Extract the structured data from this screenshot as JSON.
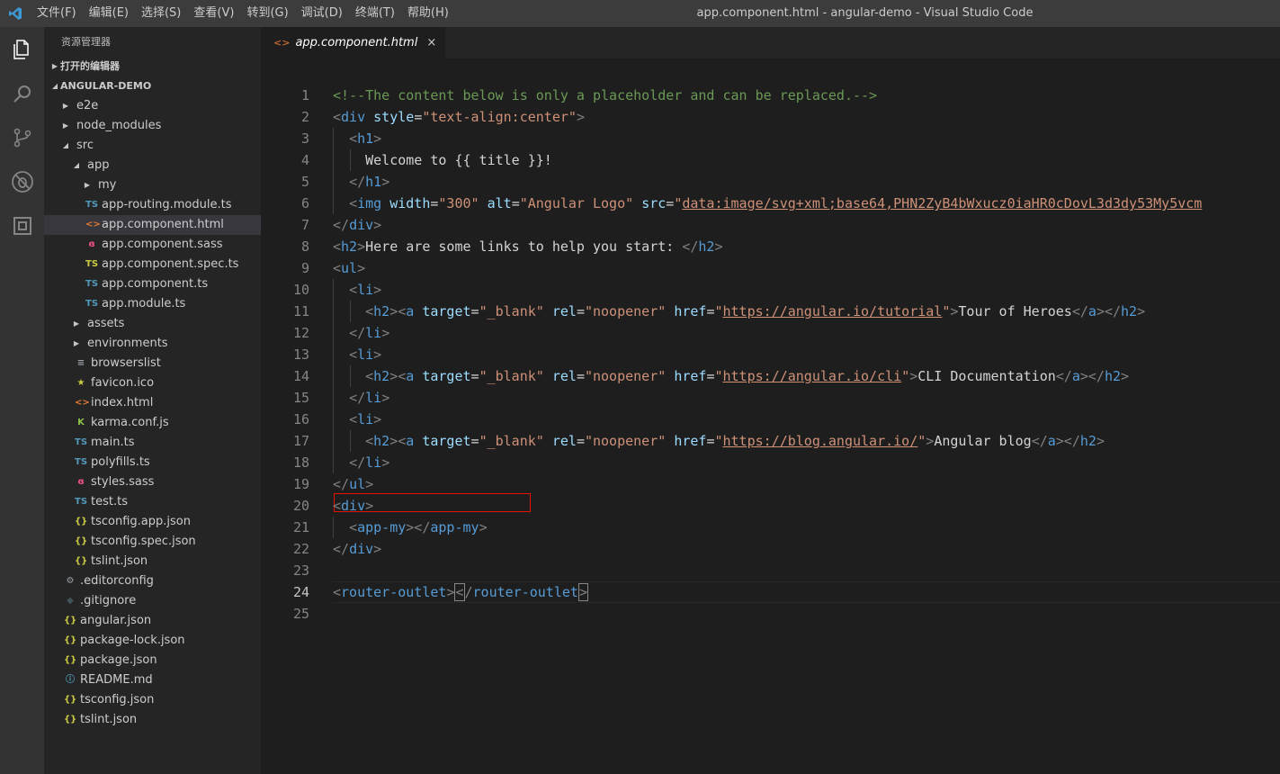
{
  "window": {
    "title": "app.component.html - angular-demo - Visual Studio Code",
    "menu": [
      "文件(F)",
      "编辑(E)",
      "选择(S)",
      "查看(V)",
      "转到(G)",
      "调试(D)",
      "终端(T)",
      "帮助(H)"
    ]
  },
  "activity_bar": [
    "files-icon",
    "search-icon",
    "source-control-icon",
    "debug-icon",
    "extensions-icon"
  ],
  "sidebar": {
    "title": "资源管理器",
    "open_editors": "打开的编辑器",
    "project": "ANGULAR-DEMO",
    "tree": [
      {
        "label": "e2e",
        "type": "folder",
        "expanded": false,
        "depth": 1
      },
      {
        "label": "node_modules",
        "type": "folder",
        "expanded": false,
        "depth": 1
      },
      {
        "label": "src",
        "type": "folder",
        "expanded": true,
        "depth": 1
      },
      {
        "label": "app",
        "type": "folder",
        "expanded": true,
        "depth": 2
      },
      {
        "label": "my",
        "type": "folder",
        "expanded": false,
        "depth": 3
      },
      {
        "label": "app-routing.module.ts",
        "type": "ts",
        "depth": 3
      },
      {
        "label": "app.component.html",
        "type": "html",
        "depth": 3,
        "selected": true
      },
      {
        "label": "app.component.sass",
        "type": "sass",
        "depth": 3
      },
      {
        "label": "app.component.spec.ts",
        "type": "spec",
        "depth": 3
      },
      {
        "label": "app.component.ts",
        "type": "ts",
        "depth": 3
      },
      {
        "label": "app.module.ts",
        "type": "ts",
        "depth": 3
      },
      {
        "label": "assets",
        "type": "folder",
        "expanded": false,
        "depth": 2
      },
      {
        "label": "environments",
        "type": "folder",
        "expanded": false,
        "depth": 2
      },
      {
        "label": "browserslist",
        "type": "list",
        "depth": 2
      },
      {
        "label": "favicon.ico",
        "type": "star",
        "depth": 2
      },
      {
        "label": "index.html",
        "type": "html",
        "depth": 2
      },
      {
        "label": "karma.conf.js",
        "type": "karma",
        "depth": 2
      },
      {
        "label": "main.ts",
        "type": "ts",
        "depth": 2
      },
      {
        "label": "polyfills.ts",
        "type": "ts",
        "depth": 2
      },
      {
        "label": "styles.sass",
        "type": "sass",
        "depth": 2
      },
      {
        "label": "test.ts",
        "type": "ts",
        "depth": 2
      },
      {
        "label": "tsconfig.app.json",
        "type": "json",
        "depth": 2
      },
      {
        "label": "tsconfig.spec.json",
        "type": "json",
        "depth": 2
      },
      {
        "label": "tslint.json",
        "type": "json",
        "depth": 2
      },
      {
        "label": ".editorconfig",
        "type": "gear",
        "depth": 1
      },
      {
        "label": ".gitignore",
        "type": "git",
        "depth": 1
      },
      {
        "label": "angular.json",
        "type": "json",
        "depth": 1
      },
      {
        "label": "package-lock.json",
        "type": "json",
        "depth": 1
      },
      {
        "label": "package.json",
        "type": "json",
        "depth": 1
      },
      {
        "label": "README.md",
        "type": "info",
        "depth": 1
      },
      {
        "label": "tsconfig.json",
        "type": "json",
        "depth": 1
      },
      {
        "label": "tslint.json",
        "type": "json",
        "depth": 1
      }
    ]
  },
  "editor": {
    "tab": {
      "label": "app.component.html",
      "icon": "html-icon",
      "close": "×"
    },
    "active_line": 24,
    "lines": [
      [
        [
          "c-com",
          "<!--The content below is only a placeholder and can be replaced.-->"
        ]
      ],
      [
        [
          "c-br",
          "<"
        ],
        [
          "c-tag",
          "div"
        ],
        [
          "c-txt",
          " "
        ],
        [
          "c-attr",
          "style"
        ],
        [
          "c-txt",
          "="
        ],
        [
          "c-str",
          "\"text-align:center\""
        ],
        [
          "c-br",
          ">"
        ]
      ],
      [
        [
          "c-txt",
          "  "
        ],
        [
          "c-br",
          "<"
        ],
        [
          "c-tag",
          "h1"
        ],
        [
          "c-br",
          ">"
        ]
      ],
      [
        [
          "c-txt",
          "    Welcome to {{ title }}!"
        ]
      ],
      [
        [
          "c-txt",
          "  "
        ],
        [
          "c-br",
          "</"
        ],
        [
          "c-tag",
          "h1"
        ],
        [
          "c-br",
          ">"
        ]
      ],
      [
        [
          "c-txt",
          "  "
        ],
        [
          "c-br",
          "<"
        ],
        [
          "c-tag",
          "img"
        ],
        [
          "c-txt",
          " "
        ],
        [
          "c-attr",
          "width"
        ],
        [
          "c-txt",
          "="
        ],
        [
          "c-str",
          "\"300\""
        ],
        [
          "c-txt",
          " "
        ],
        [
          "c-attr",
          "alt"
        ],
        [
          "c-txt",
          "="
        ],
        [
          "c-str",
          "\"Angular Logo\""
        ],
        [
          "c-txt",
          " "
        ],
        [
          "c-attr",
          "src"
        ],
        [
          "c-txt",
          "="
        ],
        [
          "c-str",
          "\""
        ],
        [
          "c-url",
          "data:image/svg+xml;base64,PHN2ZyB4bWxucz0iaHR0cDovL3d3dy53My5vcm"
        ]
      ],
      [
        [
          "c-br",
          "</"
        ],
        [
          "c-tag",
          "div"
        ],
        [
          "c-br",
          ">"
        ]
      ],
      [
        [
          "c-br",
          "<"
        ],
        [
          "c-tag",
          "h2"
        ],
        [
          "c-br",
          ">"
        ],
        [
          "c-txt",
          "Here are some links to help you start: "
        ],
        [
          "c-br",
          "</"
        ],
        [
          "c-tag",
          "h2"
        ],
        [
          "c-br",
          ">"
        ]
      ],
      [
        [
          "c-br",
          "<"
        ],
        [
          "c-tag",
          "ul"
        ],
        [
          "c-br",
          ">"
        ]
      ],
      [
        [
          "c-txt",
          "  "
        ],
        [
          "c-br",
          "<"
        ],
        [
          "c-tag",
          "li"
        ],
        [
          "c-br",
          ">"
        ]
      ],
      [
        [
          "c-txt",
          "    "
        ],
        [
          "c-br",
          "<"
        ],
        [
          "c-tag",
          "h2"
        ],
        [
          "c-br",
          "><"
        ],
        [
          "c-tag",
          "a"
        ],
        [
          "c-txt",
          " "
        ],
        [
          "c-attr",
          "target"
        ],
        [
          "c-txt",
          "="
        ],
        [
          "c-str",
          "\"_blank\""
        ],
        [
          "c-txt",
          " "
        ],
        [
          "c-attr",
          "rel"
        ],
        [
          "c-txt",
          "="
        ],
        [
          "c-str",
          "\"noopener\""
        ],
        [
          "c-txt",
          " "
        ],
        [
          "c-attr",
          "href"
        ],
        [
          "c-txt",
          "="
        ],
        [
          "c-str",
          "\""
        ],
        [
          "c-url",
          "https://angular.io/tutorial"
        ],
        [
          "c-str",
          "\""
        ],
        [
          "c-br",
          ">"
        ],
        [
          "c-txt",
          "Tour of Heroes"
        ],
        [
          "c-br",
          "</"
        ],
        [
          "c-tag",
          "a"
        ],
        [
          "c-br",
          "></"
        ],
        [
          "c-tag",
          "h2"
        ],
        [
          "c-br",
          ">"
        ]
      ],
      [
        [
          "c-txt",
          "  "
        ],
        [
          "c-br",
          "</"
        ],
        [
          "c-tag",
          "li"
        ],
        [
          "c-br",
          ">"
        ]
      ],
      [
        [
          "c-txt",
          "  "
        ],
        [
          "c-br",
          "<"
        ],
        [
          "c-tag",
          "li"
        ],
        [
          "c-br",
          ">"
        ]
      ],
      [
        [
          "c-txt",
          "    "
        ],
        [
          "c-br",
          "<"
        ],
        [
          "c-tag",
          "h2"
        ],
        [
          "c-br",
          "><"
        ],
        [
          "c-tag",
          "a"
        ],
        [
          "c-txt",
          " "
        ],
        [
          "c-attr",
          "target"
        ],
        [
          "c-txt",
          "="
        ],
        [
          "c-str",
          "\"_blank\""
        ],
        [
          "c-txt",
          " "
        ],
        [
          "c-attr",
          "rel"
        ],
        [
          "c-txt",
          "="
        ],
        [
          "c-str",
          "\"noopener\""
        ],
        [
          "c-txt",
          " "
        ],
        [
          "c-attr",
          "href"
        ],
        [
          "c-txt",
          "="
        ],
        [
          "c-str",
          "\""
        ],
        [
          "c-url",
          "https://angular.io/cli"
        ],
        [
          "c-str",
          "\""
        ],
        [
          "c-br",
          ">"
        ],
        [
          "c-txt",
          "CLI Documentation"
        ],
        [
          "c-br",
          "</"
        ],
        [
          "c-tag",
          "a"
        ],
        [
          "c-br",
          "></"
        ],
        [
          "c-tag",
          "h2"
        ],
        [
          "c-br",
          ">"
        ]
      ],
      [
        [
          "c-txt",
          "  "
        ],
        [
          "c-br",
          "</"
        ],
        [
          "c-tag",
          "li"
        ],
        [
          "c-br",
          ">"
        ]
      ],
      [
        [
          "c-txt",
          "  "
        ],
        [
          "c-br",
          "<"
        ],
        [
          "c-tag",
          "li"
        ],
        [
          "c-br",
          ">"
        ]
      ],
      [
        [
          "c-txt",
          "    "
        ],
        [
          "c-br",
          "<"
        ],
        [
          "c-tag",
          "h2"
        ],
        [
          "c-br",
          "><"
        ],
        [
          "c-tag",
          "a"
        ],
        [
          "c-txt",
          " "
        ],
        [
          "c-attr",
          "target"
        ],
        [
          "c-txt",
          "="
        ],
        [
          "c-str",
          "\"_blank\""
        ],
        [
          "c-txt",
          " "
        ],
        [
          "c-attr",
          "rel"
        ],
        [
          "c-txt",
          "="
        ],
        [
          "c-str",
          "\"noopener\""
        ],
        [
          "c-txt",
          " "
        ],
        [
          "c-attr",
          "href"
        ],
        [
          "c-txt",
          "="
        ],
        [
          "c-str",
          "\""
        ],
        [
          "c-url",
          "https://blog.angular.io/"
        ],
        [
          "c-str",
          "\""
        ],
        [
          "c-br",
          ">"
        ],
        [
          "c-txt",
          "Angular blog"
        ],
        [
          "c-br",
          "</"
        ],
        [
          "c-tag",
          "a"
        ],
        [
          "c-br",
          "></"
        ],
        [
          "c-tag",
          "h2"
        ],
        [
          "c-br",
          ">"
        ]
      ],
      [
        [
          "c-txt",
          "  "
        ],
        [
          "c-br",
          "</"
        ],
        [
          "c-tag",
          "li"
        ],
        [
          "c-br",
          ">"
        ]
      ],
      [
        [
          "c-br",
          "</"
        ],
        [
          "c-tag",
          "ul"
        ],
        [
          "c-br",
          ">"
        ]
      ],
      [
        [
          "c-br",
          "<"
        ],
        [
          "c-tag",
          "div"
        ],
        [
          "c-br",
          ">"
        ]
      ],
      [
        [
          "c-txt",
          "  "
        ],
        [
          "c-br",
          "<"
        ],
        [
          "c-tag",
          "app-my"
        ],
        [
          "c-br",
          "></"
        ],
        [
          "c-tag",
          "app-my"
        ],
        [
          "c-br",
          ">"
        ]
      ],
      [
        [
          "c-br",
          "</"
        ],
        [
          "c-tag",
          "div"
        ],
        [
          "c-br",
          ">"
        ]
      ],
      [],
      [
        [
          "c-br",
          "<"
        ],
        [
          "c-tag",
          "router-outlet"
        ],
        [
          "c-br",
          ">"
        ],
        [
          "c-br bracket-box",
          "<"
        ],
        [
          "c-br",
          "/"
        ],
        [
          "c-tag",
          "router-outlet"
        ],
        [
          "c-br bracket-box",
          ">"
        ]
      ],
      []
    ]
  },
  "colors": {
    "accent": "#007acc",
    "ts": "#519aba",
    "json": "#cbcb41",
    "html": "#e37933",
    "sass": "#f55385",
    "spec": "#cbcb41",
    "karma": "#8dc149",
    "highlight_box": "#e51400"
  }
}
